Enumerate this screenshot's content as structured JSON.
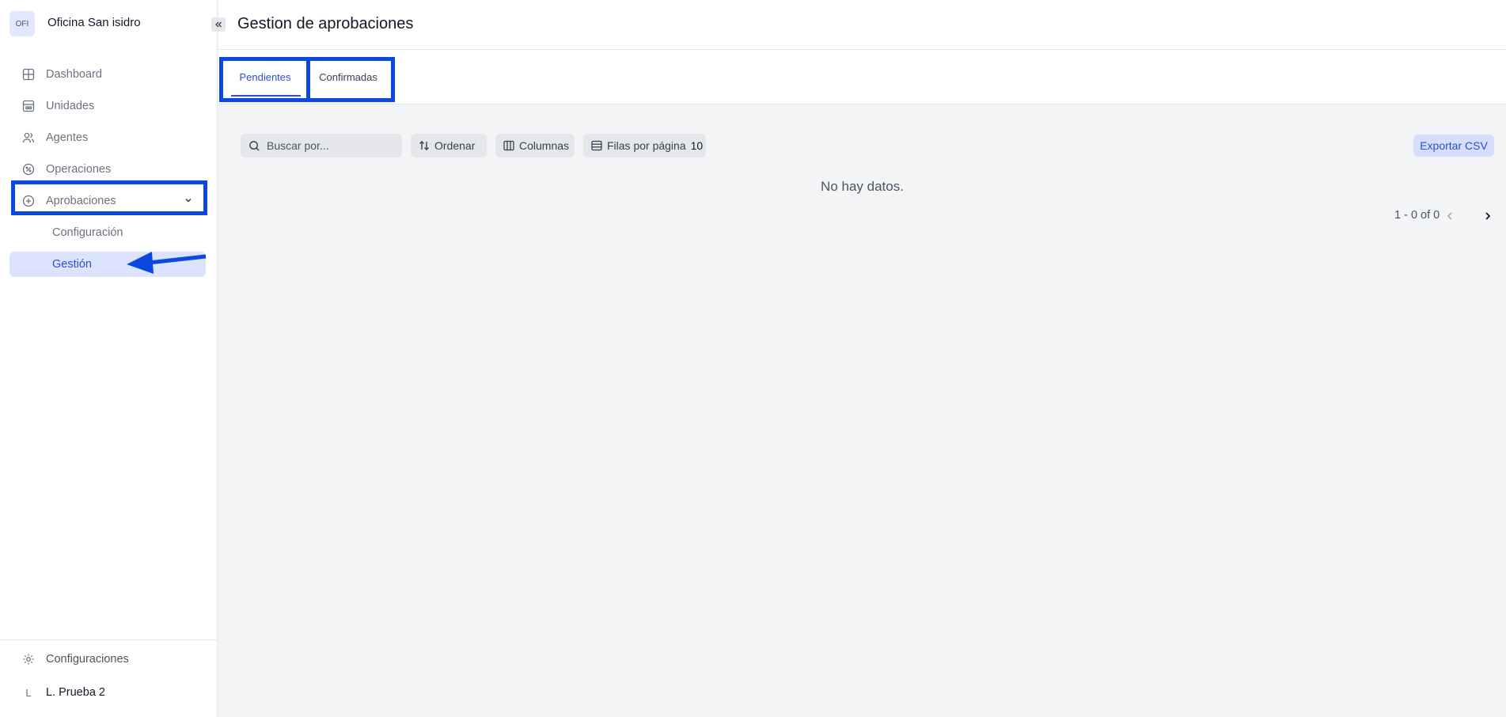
{
  "workspace": {
    "avatar_text": "OFI",
    "name": "Oficina San isidro"
  },
  "sidebar": {
    "items": [
      {
        "label": "Dashboard",
        "icon": "grid-icon"
      },
      {
        "label": "Unidades",
        "icon": "building-icon"
      },
      {
        "label": "Agentes",
        "icon": "users-icon"
      },
      {
        "label": "Operaciones",
        "icon": "percent-icon"
      },
      {
        "label": "Aprobaciones",
        "icon": "plus-circle-icon",
        "expanded": true
      }
    ],
    "subitems": [
      {
        "label": "Configuración"
      },
      {
        "label": "Gestión",
        "active": true
      }
    ],
    "footer": {
      "settings_label": "Configuraciones",
      "user_initial": "L",
      "user_name": "L. Prueba 2"
    }
  },
  "header": {
    "title": "Gestion de aprobaciones"
  },
  "tabs": [
    {
      "label": "Pendientes",
      "active": true
    },
    {
      "label": "Confirmadas",
      "active": false
    }
  ],
  "toolbar": {
    "search_placeholder": "Buscar por...",
    "sort_label": "Ordenar",
    "columns_label": "Columnas",
    "rows_per_page_label": "Filas por página",
    "rows_per_page_value": "10",
    "export_label": "Exportar CSV"
  },
  "table": {
    "empty_message": "No hay datos.",
    "pagination_text": "1 - 0 of 0"
  },
  "colors": {
    "accent": "#2c4fd1",
    "highlight": "#0b48e0",
    "active_bg": "#dbe3ff"
  }
}
